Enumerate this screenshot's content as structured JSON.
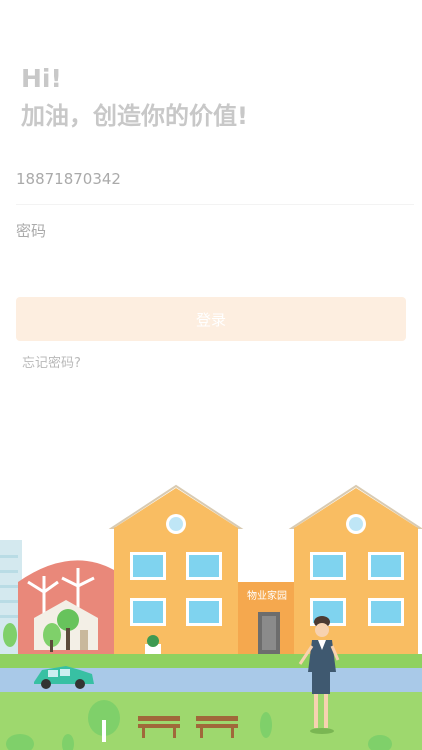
{
  "greeting": {
    "hi": "Hi!",
    "subtitle": "加油，创造你的价值!"
  },
  "form": {
    "phone_value": "18871870342",
    "password_placeholder": "密码",
    "login_label": "登录",
    "forgot_label": "忘记密码?"
  },
  "illustration": {
    "building_sign": "物业家园"
  },
  "colors": {
    "accent": "#f7b55e",
    "login_button_disabled": "#fdeee0",
    "grass": "#8fd160",
    "road": "#a9c9e8"
  }
}
